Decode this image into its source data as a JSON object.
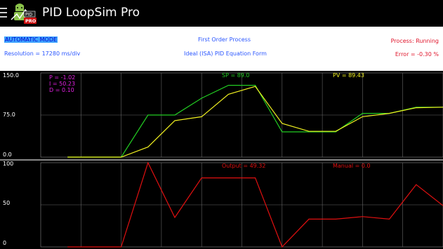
{
  "app": {
    "title": "PID LoopSim Pro",
    "badge": "PID",
    "badge_sub": "PRO"
  },
  "status": {
    "mode": "AUTOMATIC MODE",
    "resolution": "Resolution = 17280 ms/div",
    "process_type": "First Order Process",
    "equation_form": "Ideal (ISA) PID Equation Form",
    "process_state": "Process: Running",
    "error": "Error = -0.30 %"
  },
  "upper_chart": {
    "y_labels": [
      "150.0",
      "75.0",
      "0.0"
    ],
    "params": {
      "p": "P = -1.02",
      "i": "I = 50.23",
      "d": "D = 0.10"
    },
    "sp_label": "SP = 89.0",
    "pv_label": "PV = 89.43",
    "colors": {
      "sp": "#22cc22",
      "pv": "#f0f020",
      "params": "#e020e0"
    }
  },
  "lower_chart": {
    "y_labels": [
      "100",
      "50",
      "0"
    ],
    "output_label": "Output = 49.32",
    "manual_label": "Manual = 0.0",
    "colors": {
      "output": "#e01010"
    }
  },
  "chart_data": [
    {
      "type": "line",
      "title": "",
      "ylim": [
        0,
        150
      ],
      "x": [
        0,
        1,
        2,
        3,
        4,
        5,
        6,
        7,
        8,
        9,
        10,
        11,
        12,
        13,
        14,
        15
      ],
      "series": [
        {
          "name": "SP",
          "values": [
            null,
            0,
            0,
            0,
            75,
            75,
            105,
            128,
            128,
            45,
            45,
            45,
            78,
            78,
            89,
            89
          ]
        },
        {
          "name": "PV",
          "values": [
            null,
            0,
            0,
            0,
            18,
            65,
            72,
            112,
            126,
            60,
            46,
            46,
            72,
            78,
            88,
            89
          ]
        }
      ]
    },
    {
      "type": "line",
      "title": "",
      "ylim": [
        0,
        100
      ],
      "x": [
        0,
        1,
        2,
        3,
        4,
        5,
        6,
        7,
        8,
        9,
        10,
        11,
        12,
        13,
        14,
        15
      ],
      "series": [
        {
          "name": "Output",
          "values": [
            null,
            0,
            0,
            0,
            100,
            35,
            82,
            82,
            82,
            0,
            33,
            33,
            36,
            33,
            74,
            49
          ]
        }
      ]
    }
  ]
}
